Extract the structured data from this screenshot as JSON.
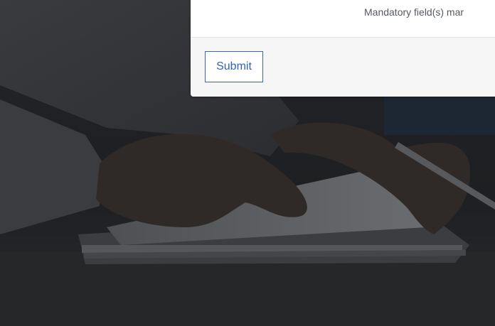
{
  "form": {
    "mandatory_note": "Mandatory field(s) mar",
    "submit_label": "Submit"
  },
  "colors": {
    "backdrop": "#1c1d20",
    "card": "#ffffff",
    "footer": "#f6f6f7",
    "accent": "#3263b3"
  }
}
